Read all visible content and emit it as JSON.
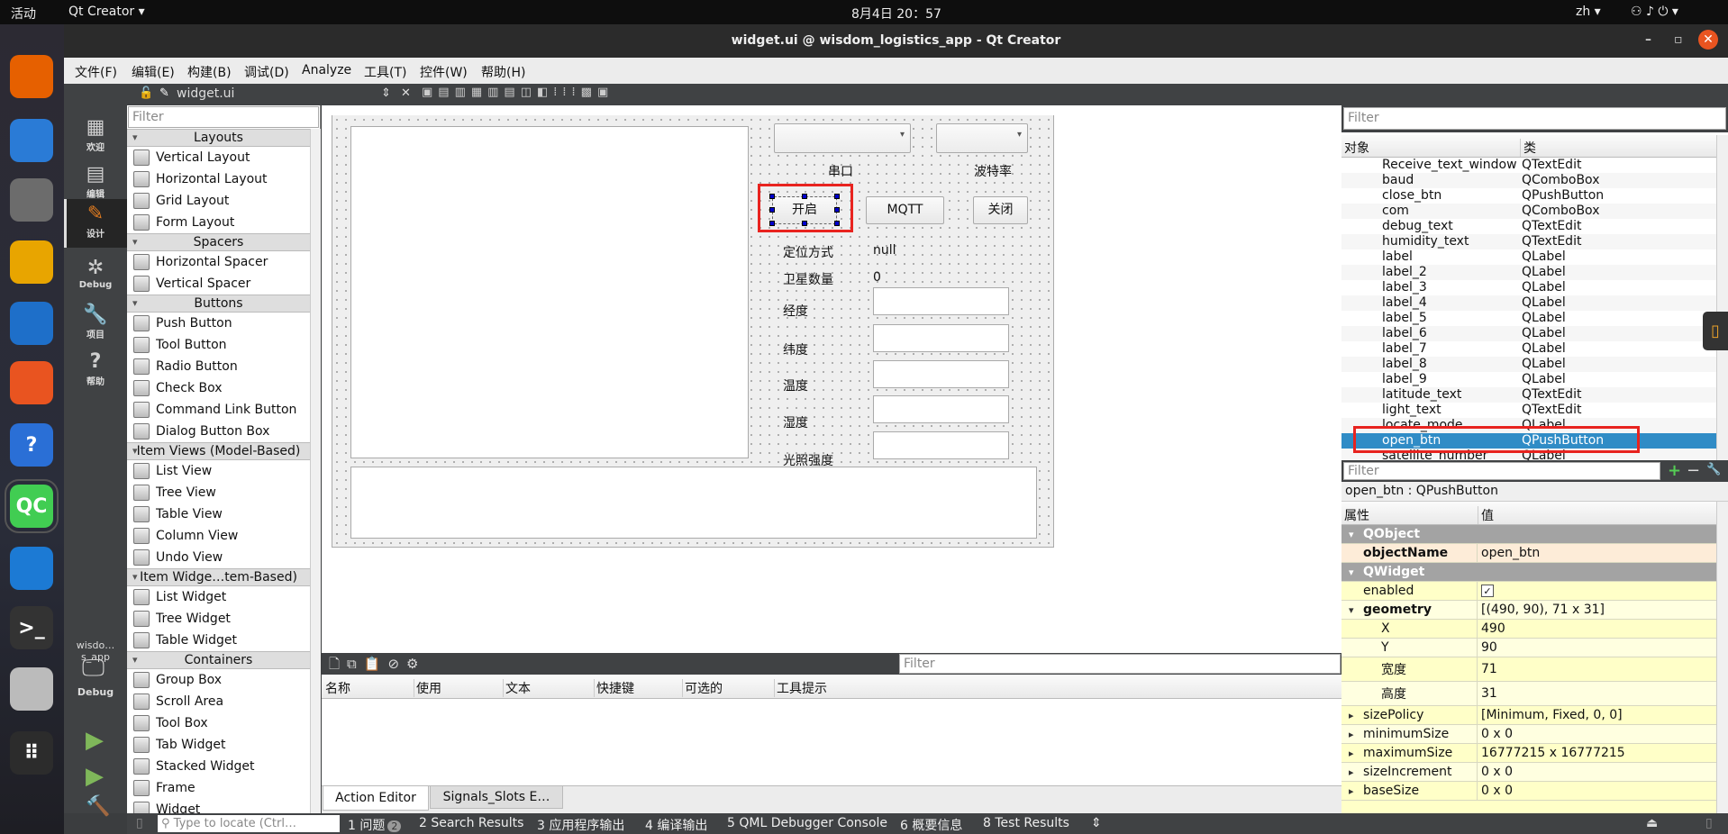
{
  "topbar": {
    "activities": "活动",
    "app": "Qt Creator ▾",
    "clock": "8月4日  20：57",
    "lang": "zh ▾",
    "sys": "⚇ ♪ ⏻ ▾"
  },
  "dock": [
    "firefox",
    "thunderbird",
    "files",
    "rhythmbox",
    "writer",
    "software",
    "help",
    "qtcreator",
    "vscode",
    "terminal",
    "dvd",
    "apps"
  ],
  "window": {
    "title": "widget.ui @ wisdom_logistics_app - Qt Creator",
    "controls": [
      "–",
      "▫",
      "✕"
    ]
  },
  "menu": [
    "文件(F)",
    "编辑(E)",
    "构建(B)",
    "调试(D)",
    "Analyze",
    "工具(T)",
    "控件(W)",
    "帮助(H)"
  ],
  "toolbar": {
    "file": "widget.ui"
  },
  "modes": [
    {
      "label": "欢迎",
      "icon": "▦"
    },
    {
      "label": "编辑",
      "icon": "▤"
    },
    {
      "label": "设计",
      "icon": "✎"
    },
    {
      "label": "Debug",
      "icon": "✲"
    },
    {
      "label": "项目",
      "icon": "🔧"
    },
    {
      "label": "帮助",
      "icon": "?"
    }
  ],
  "kit": {
    "project": "wisdo…s_app",
    "config": "Debug"
  },
  "widgetbox": {
    "filter_placeholder": "Filter",
    "groups": [
      {
        "title": "Layouts",
        "items": [
          "Vertical Layout",
          "Horizontal Layout",
          "Grid Layout",
          "Form Layout"
        ]
      },
      {
        "title": "Spacers",
        "items": [
          "Horizontal Spacer",
          "Vertical Spacer"
        ]
      },
      {
        "title": "Buttons",
        "items": [
          "Push Button",
          "Tool Button",
          "Radio Button",
          "Check Box",
          "Command Link Button",
          "Dialog Button Box"
        ]
      },
      {
        "title": "Item Views (Model-Based)",
        "items": [
          "List View",
          "Tree View",
          "Table View",
          "Column View",
          "Undo View"
        ]
      },
      {
        "title": "Item Widge…tem-Based)",
        "items": [
          "List Widget",
          "Tree Widget",
          "Table Widget"
        ]
      },
      {
        "title": "Containers",
        "items": [
          "Group Box",
          "Scroll Area",
          "Tool Box",
          "Tab Widget",
          "Stacked Widget",
          "Frame",
          "Widget"
        ]
      }
    ]
  },
  "form": {
    "serial_label": "串口",
    "baud_label": "波特率",
    "open": "开启",
    "mqtt": "MQTT",
    "close": "关闭",
    "locate_label": "定位方式",
    "locate_value": "null",
    "sat_label": "卫星数量",
    "sat_value": "0",
    "fields": [
      "经度",
      "纬度",
      "温度",
      "湿度",
      "光照强度"
    ]
  },
  "action_editor": {
    "filter_placeholder": "Filter",
    "columns": [
      "名称",
      "使用",
      "文本",
      "快捷键",
      "可选的",
      "工具提示"
    ],
    "tabs": [
      "Action Editor",
      "Signals_Slots E…"
    ]
  },
  "object_inspector": {
    "filter_placeholder": "Filter",
    "headers": [
      "对象",
      "类"
    ],
    "selected": "open_btn",
    "rows": [
      [
        "Receive_text_window",
        "QTextEdit"
      ],
      [
        "baud",
        "QComboBox"
      ],
      [
        "close_btn",
        "QPushButton"
      ],
      [
        "com",
        "QComboBox"
      ],
      [
        "debug_text",
        "QTextEdit"
      ],
      [
        "humidity_text",
        "QTextEdit"
      ],
      [
        "label",
        "QLabel"
      ],
      [
        "label_2",
        "QLabel"
      ],
      [
        "label_3",
        "QLabel"
      ],
      [
        "label_4",
        "QLabel"
      ],
      [
        "label_5",
        "QLabel"
      ],
      [
        "label_6",
        "QLabel"
      ],
      [
        "label_7",
        "QLabel"
      ],
      [
        "label_8",
        "QLabel"
      ],
      [
        "label_9",
        "QLabel"
      ],
      [
        "latitude_text",
        "QTextEdit"
      ],
      [
        "light_text",
        "QTextEdit"
      ],
      [
        "locate_mode",
        "QLabel"
      ],
      [
        "open_btn",
        "QPushButton"
      ],
      [
        "satellite_number",
        "QLabel"
      ]
    ]
  },
  "property_editor": {
    "filter_placeholder": "Filter",
    "object": "open_btn : QPushButton",
    "headers": [
      "属性",
      "值"
    ],
    "rows": [
      {
        "name": "QObject",
        "type": "group"
      },
      {
        "name": "objectName",
        "value": "open_btn",
        "type": "bold"
      },
      {
        "name": "QWidget",
        "type": "group"
      },
      {
        "name": "enabled",
        "value": "✓",
        "type": "check"
      },
      {
        "name": "geometry",
        "value": "[(490, 90), 71 x 31]",
        "type": "expanded"
      },
      {
        "name": "X",
        "value": "490",
        "type": "sub"
      },
      {
        "name": "Y",
        "value": "90",
        "type": "sub"
      },
      {
        "name": "宽度",
        "value": "71",
        "type": "sub"
      },
      {
        "name": "高度",
        "value": "31",
        "type": "sub"
      },
      {
        "name": "sizePolicy",
        "value": "[Minimum, Fixed, 0, 0]",
        "type": "collapsed"
      },
      {
        "name": "minimumSize",
        "value": "0 x 0",
        "type": "collapsed"
      },
      {
        "name": "maximumSize",
        "value": "16777215 x 16777215",
        "type": "collapsed"
      },
      {
        "name": "sizeIncrement",
        "value": "0 x 0",
        "type": "collapsed"
      },
      {
        "name": "baseSize",
        "value": "0 x 0",
        "type": "collapsed"
      }
    ]
  },
  "status": {
    "locate_placeholder": "Type to locate (Ctrl…",
    "items": [
      "1 问题",
      "2 Search Results",
      "3 应用程序输出",
      "4 编译输出",
      "5 QML Debugger Console",
      "6 概要信息",
      "8 Test Results"
    ],
    "issues_count": "2"
  },
  "colors": {
    "selection": "#308cc6",
    "highlight_box": "#e8231f",
    "property_yellow": "#ffffc8",
    "group_gray": "#a3a3a3"
  }
}
